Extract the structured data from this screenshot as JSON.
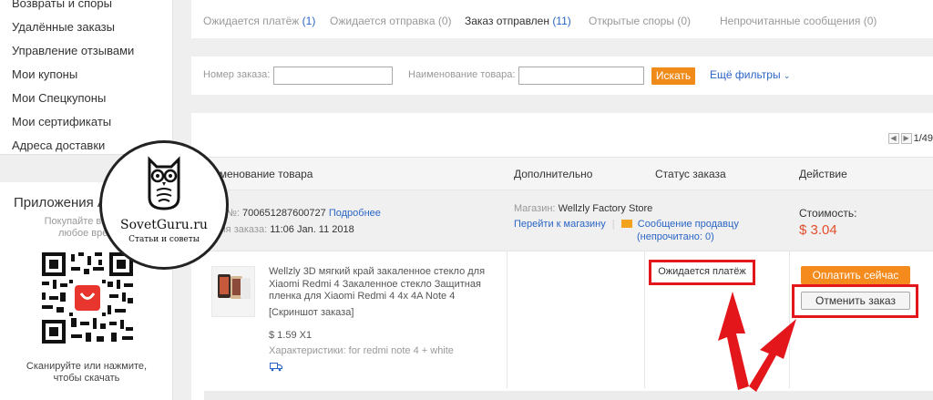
{
  "sidebar": {
    "items": [
      {
        "label": "Возвраты и споры"
      },
      {
        "label": "Удалённые заказы"
      },
      {
        "label": "Управление отзывами"
      },
      {
        "label": "Мои купоны"
      },
      {
        "label": "Мои Спецкупоны"
      },
      {
        "label": "Мои сертификаты"
      },
      {
        "label": "Адреса доставки"
      }
    ]
  },
  "apps": {
    "title": "Приложения A",
    "subtitle_line1": "Покупайте в любо",
    "subtitle_line2": "любое врем",
    "scan_line1": "Сканируйте или нажмите,",
    "scan_line2": "чтобы скачать"
  },
  "tabs": [
    {
      "label": "Ожидается платёж",
      "count": "(1)"
    },
    {
      "label": "Ожидается отправка",
      "count": "(0)"
    },
    {
      "label": "Заказ отправлен",
      "count": "(11)"
    },
    {
      "label": "Открытые споры",
      "count": "(0)"
    },
    {
      "label": "Непрочитанные сообщения",
      "count": "(0)"
    }
  ],
  "filters": {
    "order_number_label": "Номер заказа:",
    "order_number_value": "",
    "product_name_label": "Наименование товара:",
    "product_name_value": "",
    "search_label": "Искать",
    "more_filters_label": "Ещё фильтры"
  },
  "pager": {
    "text": "1/49"
  },
  "table": {
    "col_product": "именование товара",
    "col_extra": "Дополнительно",
    "col_status": "Статус заказа",
    "col_action": "Действие"
  },
  "order": {
    "number_label": "аз №:",
    "number": "700651287600727",
    "details_link": "Подробнее",
    "time_label": "емя заказа:",
    "time": "11:06 Jan. 11 2018",
    "store_label": "Магазин:",
    "store_name": "Wellzly Factory Store",
    "store_link": "Перейти к магазину",
    "message_link": "Сообщение продавцу",
    "message_unread": "(непрочитано: 0)",
    "cost_label": "Стоимость:",
    "cost": "$ 3.04",
    "product_name": "Wellzly 3D мягкий край закаленное стекло для Xiaomi Redmi 4 Закаленное стекло Защитная пленка для Xiaomi Redmi 4 4x 4A Note 4",
    "snapshot": "[Скриншот заказа]",
    "unit_price": "$ 1.59 X1",
    "characteristics": "Характеристики: for redmi note 4 + white",
    "status": "Ожидается платёж",
    "pay_label": "Оплатить сейчас",
    "cancel_label": "Отменить заказ"
  },
  "watermark": {
    "brand": "SovetGuru.ru",
    "slogan": "Статьи и советы"
  },
  "colors": {
    "accent_orange": "#f08a18",
    "link_blue": "#2a65c5",
    "price_red": "#e34e2c",
    "highlight_red": "#e2161b"
  }
}
